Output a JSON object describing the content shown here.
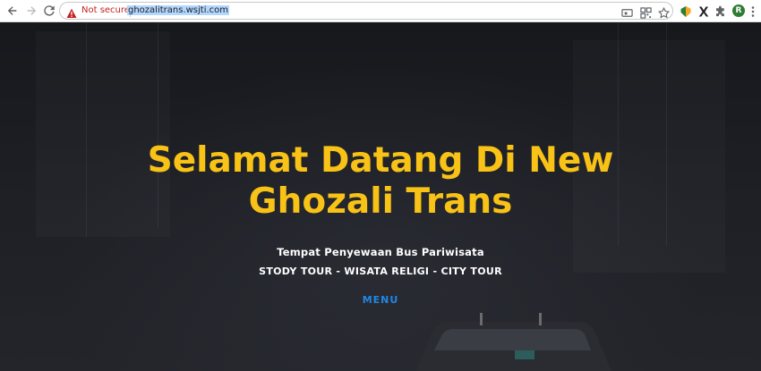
{
  "browser": {
    "security_label": "Not secure",
    "url": "ghozalitrans.wsjti.com",
    "profile_initial": "R",
    "accent_color": "#1a73e8",
    "warning_color": "#c5221f",
    "icons": [
      "back-icon",
      "forward-icon",
      "reload-icon",
      "warning-icon",
      "cast-icon",
      "qr-code-icon",
      "star-icon",
      "extension-shield-icon",
      "x-extension-icon",
      "puzzle-icon",
      "avatar",
      "more-vert-icon"
    ]
  },
  "hero": {
    "title_line1": "Selamat Datang Di New",
    "title_line2": "Ghozali Trans",
    "subtitle": "Tempat Penyewaan Bus Pariwisata",
    "tours": "STODY TOUR - WISATA RELIGI - CITY TOUR",
    "menu_label": "MENU",
    "title_color": "#f8c216",
    "menu_color": "#1e88e5"
  }
}
